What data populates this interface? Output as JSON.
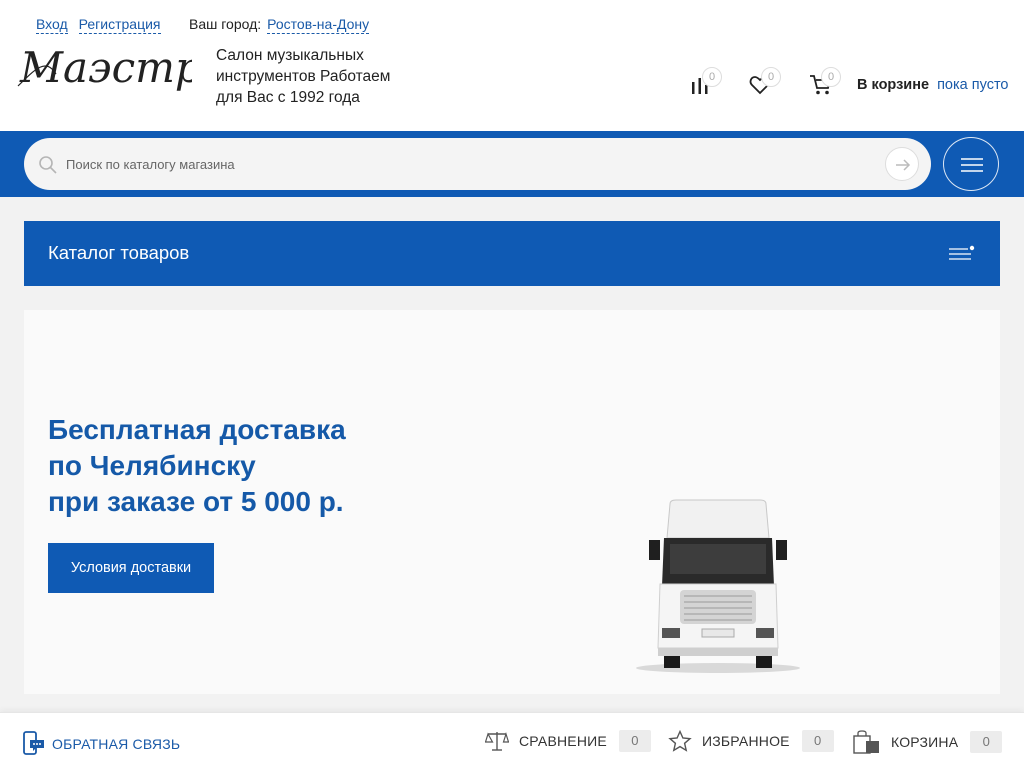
{
  "header": {
    "auth": {
      "login": "Вход",
      "register": "Регистрация"
    },
    "city": {
      "label": "Ваш город:",
      "value": "Ростов-на-Дону"
    },
    "logo_text": "Маэстро",
    "tagline": "Салон музыкальных инструментов Работаем для Вас с 1992 года",
    "icons": {
      "compare": {
        "icon": "compare-bars-icon",
        "count": "0"
      },
      "favorites": {
        "icon": "heart-icon",
        "count": "0"
      },
      "cart": {
        "icon": "cart-icon",
        "count": "0"
      }
    },
    "cart_label": "В корзине",
    "cart_status": "пока пусто"
  },
  "search": {
    "placeholder": "Поиск по каталогу магазина",
    "value": ""
  },
  "catalog": {
    "title": "Каталог товаров"
  },
  "banner": {
    "title_lines": [
      "Бесплатная доставка",
      "по Челябинску",
      "при заказе от 5 000 р."
    ],
    "button": "Условия доставки"
  },
  "bottom": {
    "feedback": "ОБРАТНАЯ СВЯЗЬ",
    "compare": {
      "label": "СРАВНЕНИЕ",
      "count": "0"
    },
    "favorites": {
      "label": "ИЗБРАННОЕ",
      "count": "0"
    },
    "cart": {
      "label": "КОРЗИНА",
      "count": "0"
    }
  },
  "colors": {
    "brand_blue": "#0f5ab4",
    "link_blue": "#1a5aa8",
    "title_blue": "#1559a8"
  }
}
